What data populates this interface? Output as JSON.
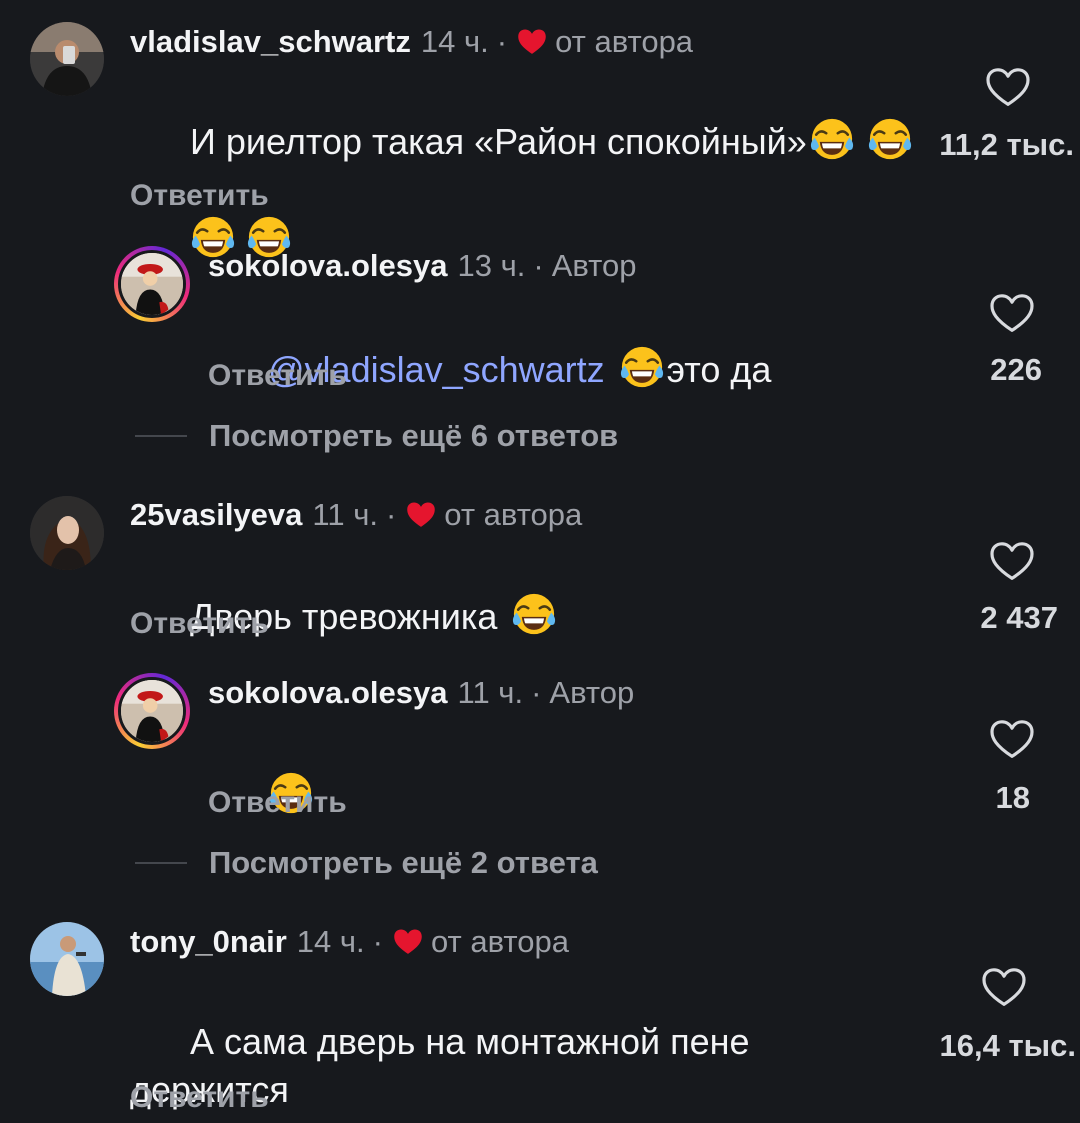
{
  "comments": [
    {
      "username": "vladislav_schwartz",
      "time": "14 ч.",
      "sep": "·",
      "badge": "от автора",
      "text_1": "И риелтор такая «Район спокойный»",
      "reply": "Ответить",
      "likes": "11,2 тыс."
    },
    {
      "username": "sokolova.olesya",
      "time": "13 ч.",
      "sep": "·",
      "badge": "Автор",
      "mention": "@vladislav_schwartz",
      "text_1": "это да",
      "reply": "Ответить",
      "likes": "226",
      "more": "Посмотреть ещё 6 ответов"
    },
    {
      "username": "25vasilyeva",
      "time": "11 ч.",
      "sep": "·",
      "badge": "от автора",
      "text_1": "Дверь тревожника",
      "reply": "Ответить",
      "likes": "2 437"
    },
    {
      "username": "sokolova.olesya",
      "time": "11 ч.",
      "sep": "·",
      "badge": "Автор",
      "reply": "Ответить",
      "likes": "18",
      "more": "Посмотреть ещё 2 ответа"
    },
    {
      "username": "tony_0nair",
      "time": "14 ч.",
      "sep": "·",
      "badge": "от автора",
      "text_1": "А сама дверь на монтажной пене",
      "text_2": "держится",
      "reply": "Ответить",
      "likes": "16,4 тыс."
    }
  ],
  "icons": {
    "emoji": "face-with-tears-of-joy-icon",
    "like": "heart-outline-icon",
    "author_like": "red-heart-icon"
  },
  "colors": {
    "background": "#17191d",
    "mention": "#8fa6ff",
    "heart": "#e5152e",
    "secondary_text": "#9ea1a8"
  }
}
